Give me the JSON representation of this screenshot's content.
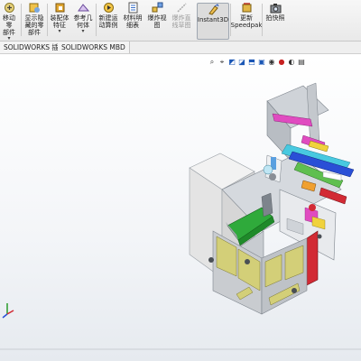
{
  "ribbon": {
    "buttons": [
      {
        "id": "move-component",
        "icon": "move-component-icon",
        "label": "移动零\n部件"
      },
      {
        "id": "show-hidden",
        "icon": "show-hidden-icon",
        "label": "显示隐\n藏的零\n部件"
      },
      {
        "id": "assembly-feature",
        "icon": "assembly-feature-icon",
        "label": "装配体\n特征"
      },
      {
        "id": "reference-geometry",
        "icon": "reference-geometry-icon",
        "label": "参考几\n何体"
      },
      {
        "id": "new-motion-study",
        "icon": "motion-study-icon",
        "label": "新建运\n动算例"
      },
      {
        "id": "bill-of-materials",
        "icon": "bom-icon",
        "label": "材料明\n细表"
      },
      {
        "id": "exploded-view",
        "icon": "exploded-view-icon",
        "label": "爆炸视\n图"
      },
      {
        "id": "explode-line-sketch",
        "icon": "explode-line-icon",
        "label": "爆炸直\n线草图"
      },
      {
        "id": "instant3d",
        "icon": "instant3d-icon",
        "label": "Instant3D"
      },
      {
        "id": "update-speedpak",
        "icon": "speedpak-icon",
        "label": "更新\nSpeedpak"
      },
      {
        "id": "take-snapshot",
        "icon": "snapshot-icon",
        "label": "拍快照"
      }
    ]
  },
  "tabs": [
    "SOLIDWORKS 插件",
    "SOLIDWORKS MBD"
  ],
  "headsup": [
    "zoom-fit-icon",
    "zoom-area-icon",
    "previous-view-icon",
    "section-view-icon",
    "view-orientation-icon",
    "display-style-icon",
    "hide-show-icon",
    "edit-appearance-icon",
    "scene-icon",
    "view-settings-icon"
  ],
  "colors": {
    "frame": "#b9bec4",
    "cabinet": "#e6e6e6",
    "green": "#2faa3b",
    "yellow": "#d3cf78",
    "magenta": "#e04bc0",
    "red": "#d22a34",
    "blue": "#2a4fd6",
    "cyan": "#48c9e0"
  }
}
